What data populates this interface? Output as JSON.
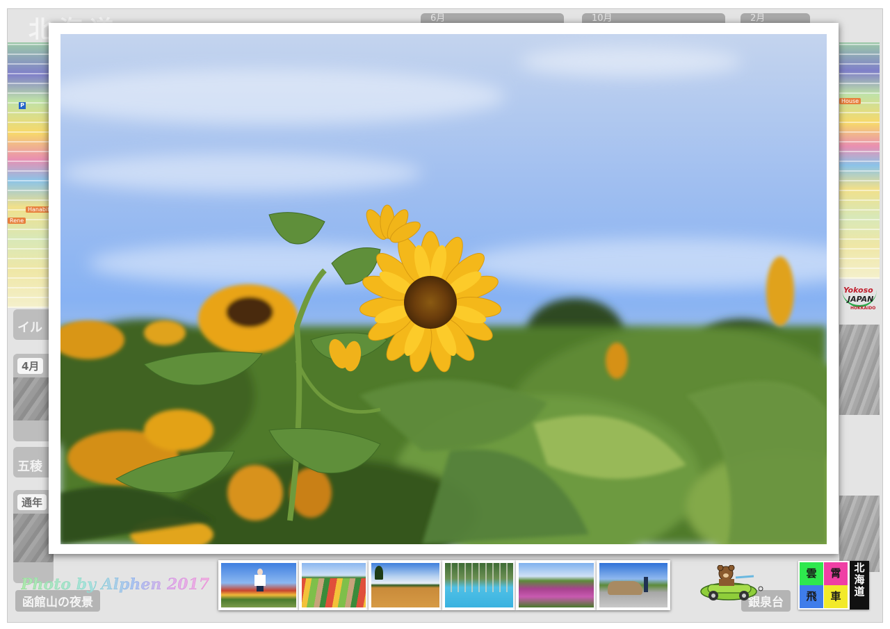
{
  "background": {
    "month_tags": [
      "4月",
      "五稜",
      "通年"
    ],
    "top_pills": [
      "6月",
      "10月",
      "2月"
    ],
    "side_caption": "イル",
    "captions": [
      "函館山の夜景",
      "銀泉台"
    ],
    "map_pins": [
      "Hanabito",
      "Rene",
      "House"
    ],
    "parking_label": "P"
  },
  "partner_logo": {
    "line1": "Yokoso",
    "line2": "JAPAN",
    "line3": "HOKKAIDO"
  },
  "lightbox": {
    "photo_subject": "sunflower field under blue sky",
    "colors": {
      "sky": "#87b2f3",
      "petal": "#f7c21a",
      "leaf": "#5f8f3a"
    }
  },
  "credit": {
    "text": "Photo by Alphen  2017"
  },
  "thumbnails": [
    {
      "subject": "girl jumping in flower field"
    },
    {
      "subject": "striped flower fields"
    },
    {
      "subject": "golden wheat field with lone tree"
    },
    {
      "subject": "blue pond with dead trees"
    },
    {
      "subject": "purple lupine field"
    },
    {
      "subject": "car parked by field"
    }
  ],
  "site_logo": {
    "cells": [
      "雲",
      "霄",
      "飛",
      "車"
    ],
    "vertical": "北海道",
    "colors": [
      "#2ee84e",
      "#ef3fa5",
      "#3f7dea",
      "#f2ea2a"
    ]
  }
}
